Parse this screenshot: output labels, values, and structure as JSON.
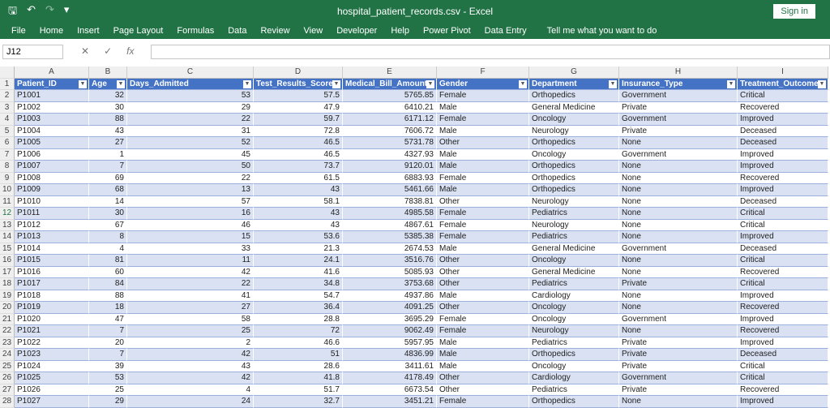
{
  "title": "hospital_patient_records.csv  -  Excel",
  "sign_in": "Sign in",
  "ribbon": [
    "File",
    "Home",
    "Insert",
    "Page Layout",
    "Formulas",
    "Data",
    "Review",
    "View",
    "Developer",
    "Help",
    "Power Pivot",
    "Data Entry",
    "Tell me what you want to do"
  ],
  "name_box": "J12",
  "columns": [
    "A",
    "B",
    "C",
    "D",
    "E",
    "F",
    "G",
    "H",
    "I"
  ],
  "headers": [
    "Patient_ID",
    "Age",
    "Days_Admitted",
    "Test_Results_Score",
    "Medical_Bill_Amount",
    "Gender",
    "Department",
    "Insurance_Type",
    "Treatment_Outcome"
  ],
  "rows": [
    [
      "P1001",
      "32",
      "53",
      "57.5",
      "5765.85",
      "Female",
      "Orthopedics",
      "Government",
      "Critical"
    ],
    [
      "P1002",
      "30",
      "29",
      "47.9",
      "6410.21",
      "Male",
      "General Medicine",
      "Private",
      "Recovered"
    ],
    [
      "P1003",
      "88",
      "22",
      "59.7",
      "6171.12",
      "Female",
      "Oncology",
      "Government",
      "Improved"
    ],
    [
      "P1004",
      "43",
      "31",
      "72.8",
      "7606.72",
      "Male",
      "Neurology",
      "Private",
      "Deceased"
    ],
    [
      "P1005",
      "27",
      "52",
      "46.5",
      "5731.78",
      "Other",
      "Orthopedics",
      "None",
      "Deceased"
    ],
    [
      "P1006",
      "1",
      "45",
      "46.5",
      "4327.93",
      "Male",
      "Oncology",
      "Government",
      "Improved"
    ],
    [
      "P1007",
      "7",
      "50",
      "73.7",
      "9120.01",
      "Male",
      "Orthopedics",
      "None",
      "Improved"
    ],
    [
      "P1008",
      "69",
      "22",
      "61.5",
      "6883.93",
      "Female",
      "Orthopedics",
      "None",
      "Recovered"
    ],
    [
      "P1009",
      "68",
      "13",
      "43",
      "5461.66",
      "Male",
      "Orthopedics",
      "None",
      "Improved"
    ],
    [
      "P1010",
      "14",
      "57",
      "58.1",
      "7838.81",
      "Other",
      "Neurology",
      "None",
      "Deceased"
    ],
    [
      "P1011",
      "30",
      "16",
      "43",
      "4985.58",
      "Female",
      "Pediatrics",
      "None",
      "Critical"
    ],
    [
      "P1012",
      "67",
      "46",
      "43",
      "4867.61",
      "Female",
      "Neurology",
      "None",
      "Critical"
    ],
    [
      "P1013",
      "8",
      "15",
      "53.6",
      "5385.38",
      "Female",
      "Pediatrics",
      "None",
      "Improved"
    ],
    [
      "P1014",
      "4",
      "33",
      "21.3",
      "2674.53",
      "Male",
      "General Medicine",
      "Government",
      "Deceased"
    ],
    [
      "P1015",
      "81",
      "11",
      "24.1",
      "3516.76",
      "Other",
      "Oncology",
      "None",
      "Critical"
    ],
    [
      "P1016",
      "60",
      "42",
      "41.6",
      "5085.93",
      "Other",
      "General Medicine",
      "None",
      "Recovered"
    ],
    [
      "P1017",
      "84",
      "22",
      "34.8",
      "3753.68",
      "Other",
      "Pediatrics",
      "Private",
      "Critical"
    ],
    [
      "P1018",
      "88",
      "41",
      "54.7",
      "4937.86",
      "Male",
      "Cardiology",
      "None",
      "Improved"
    ],
    [
      "P1019",
      "18",
      "27",
      "36.4",
      "4091.25",
      "Other",
      "Oncology",
      "None",
      "Recovered"
    ],
    [
      "P1020",
      "47",
      "58",
      "28.8",
      "3695.29",
      "Female",
      "Oncology",
      "Government",
      "Improved"
    ],
    [
      "P1021",
      "7",
      "25",
      "72",
      "9062.49",
      "Female",
      "Neurology",
      "None",
      "Recovered"
    ],
    [
      "P1022",
      "20",
      "2",
      "46.6",
      "5957.95",
      "Male",
      "Pediatrics",
      "Private",
      "Improved"
    ],
    [
      "P1023",
      "7",
      "42",
      "51",
      "4836.99",
      "Male",
      "Orthopedics",
      "Private",
      "Deceased"
    ],
    [
      "P1024",
      "39",
      "43",
      "28.6",
      "3411.61",
      "Male",
      "Oncology",
      "Private",
      "Critical"
    ],
    [
      "P1025",
      "53",
      "42",
      "41.8",
      "4178.49",
      "Other",
      "Cardiology",
      "Government",
      "Critical"
    ],
    [
      "P1026",
      "25",
      "4",
      "51.7",
      "6673.54",
      "Other",
      "Pediatrics",
      "Private",
      "Recovered"
    ],
    [
      "P1027",
      "29",
      "24",
      "32.7",
      "3451.21",
      "Female",
      "Orthopedics",
      "None",
      "Improved"
    ]
  ]
}
